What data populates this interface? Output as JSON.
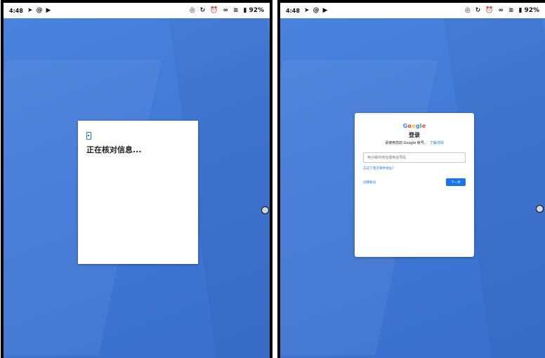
{
  "status": {
    "time": "4:48",
    "battery": "92%",
    "left_icons": [
      "send-icon",
      "at-icon",
      "play-icon"
    ],
    "right_icons": [
      "bulb-icon",
      "sync-icon",
      "alarm-icon",
      "link-icon",
      "wifi-icon",
      "battery-icon"
    ]
  },
  "left_screen": {
    "verify_text": "正在核对信息..."
  },
  "right_screen": {
    "logo": "Google",
    "title": "登录",
    "subtitle": "请使用您的 Google 帐号。",
    "learn_more": "了解详情",
    "email_placeholder": "电子邮件地址或电话号码",
    "forgot_email": "忘记了电子邮件地址?",
    "create_account": "创建帐号",
    "next": "下一步"
  }
}
